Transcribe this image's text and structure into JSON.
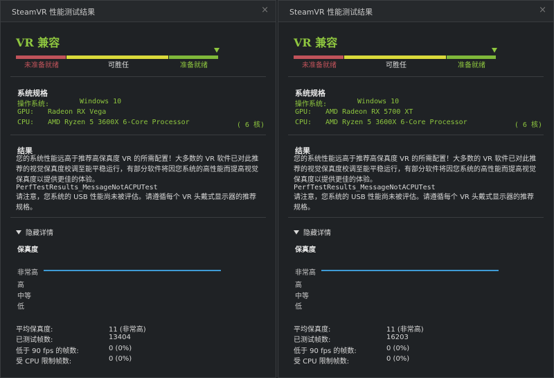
{
  "panels": [
    {
      "title": "SteamVR 性能测试结果",
      "close": "×",
      "compat_title": "VR 兼容",
      "bar_labels": {
        "red": "未准备就绪",
        "yellow": "可胜任",
        "green": "准备就绪"
      },
      "specs_heading": "系统规格",
      "os_label": "操作系统:",
      "os_value": "Windows 10",
      "gpu_label": "GPU:",
      "gpu_value": "Radeon RX Vega",
      "cpu_label": "CPU:",
      "cpu_value": "AMD Ryzen 5 3600X 6-Core Processor",
      "cpu_cores": "( 6 核)",
      "result_heading": "结果",
      "result_text": "您的系统性能远高于推荐高保真度 VR 的所需配置！大多数的 VR 软件已对此推荐的视觉保真度校调至能平稳运行，有部分软件将因您系统的高性能而提高视觉保真度以提供更佳的体验。",
      "cpu_test_key": "PerfTestResults_MessageNotACPUTest",
      "usb_text": "请注意，您系统的 USB 性能尚未被评估。请遵循每个 VR 头戴式显示器的推荐规格。",
      "toggle_label": "隐藏详情",
      "fidelity_heading": "保真度",
      "levels": [
        "非常高",
        "高",
        "中等",
        "低"
      ],
      "fidelity_level": "非常高",
      "stats": [
        {
          "label": "平均保真度:",
          "value": "11 (非常高)"
        },
        {
          "label": "已测试帧数:",
          "value": "13404"
        },
        {
          "label": "低于 90 fps 的帧数:",
          "value": "0 (0%)"
        },
        {
          "label": "受 CPU 限制帧数:",
          "value": "0 (0%)"
        }
      ]
    },
    {
      "title": "SteamVR 性能测试结果",
      "close": "×",
      "compat_title": "VR 兼容",
      "bar_labels": {
        "red": "未准备就绪",
        "yellow": "可胜任",
        "green": "准备就绪"
      },
      "specs_heading": "系统规格",
      "os_label": "操作系统:",
      "os_value": "Windows 10",
      "gpu_label": "GPU:",
      "gpu_value": "AMD Radeon RX 5700 XT",
      "cpu_label": "CPU:",
      "cpu_value": "AMD Ryzen 5 3600X 6-Core Processor",
      "cpu_cores": "( 6 核)",
      "result_heading": "结果",
      "result_text": "您的系统性能远高于推荐高保真度 VR 的所需配置！大多数的 VR 软件已对此推荐的视觉保真度校调至能平稳运行，有部分软件将因您系统的高性能而提高视觉保真度以提供更佳的体验。",
      "cpu_test_key": "PerfTestResults_MessageNotACPUTest",
      "usb_text": "请注意，您系统的 USB 性能尚未被评估。请遵循每个 VR 头戴式显示器的推荐规格。",
      "toggle_label": "隐藏详情",
      "fidelity_heading": "保真度",
      "levels": [
        "非常高",
        "高",
        "中等",
        "低"
      ],
      "fidelity_level": "非常高",
      "stats": [
        {
          "label": "平均保真度:",
          "value": "11 (非常高)"
        },
        {
          "label": "已测试帧数:",
          "value": "16203"
        },
        {
          "label": "低于 90 fps 的帧数:",
          "value": "0 (0%)"
        },
        {
          "label": "受 CPU 限制帧数:",
          "value": "0 (0%)"
        }
      ]
    }
  ],
  "colors": {
    "green": "#8ec63f",
    "yellow": "#dada3b",
    "red": "#c0535a",
    "fidelity_line": "#3f9bd6"
  }
}
